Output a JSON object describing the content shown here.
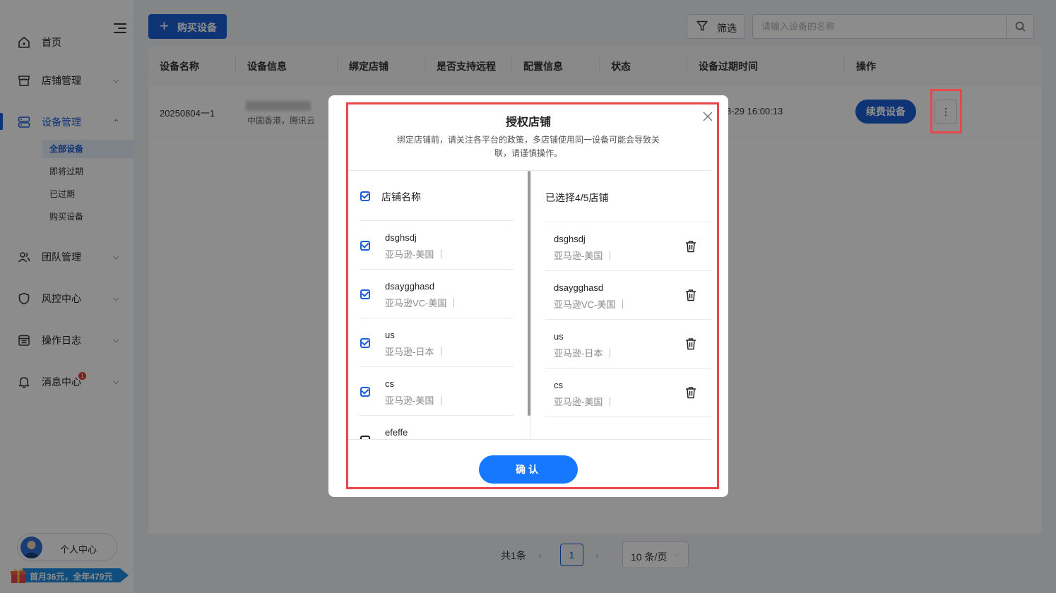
{
  "sidebar": {
    "nav": [
      {
        "label": "首页",
        "icon": "home-icon"
      },
      {
        "label": "店铺管理",
        "icon": "store-icon"
      },
      {
        "label": "设备管理",
        "icon": "device-icon"
      },
      {
        "label": "团队管理",
        "icon": "team-icon"
      },
      {
        "label": "风控中心",
        "icon": "shield-icon"
      },
      {
        "label": "操作日志",
        "icon": "log-icon"
      },
      {
        "label": "消息中心",
        "icon": "bell-icon"
      }
    ],
    "sub_items": [
      "全部设备",
      "即将过期",
      "已过期",
      "购买设备"
    ],
    "message_badge": "1",
    "profile_label": "个人中心",
    "promo_text": "首月36元，全年479元"
  },
  "toolbar": {
    "buy_label": "购买设备",
    "filter_label": "筛选",
    "search_placeholder": "请输入设备的名称"
  },
  "table": {
    "columns": [
      "设备名称",
      "设备信息",
      "绑定店铺",
      "是否支持远程",
      "配置信息",
      "状态",
      "设备过期时间",
      "操作"
    ],
    "row": {
      "name": "20250804一1",
      "info_sub": "中国香港，腾讯云",
      "expire": "8-29 16:00:13",
      "renew_label": "续费设备",
      "more_label": "⋮"
    }
  },
  "pagination": {
    "total": "共1条",
    "page": "1",
    "page_size": "10 条/页"
  },
  "modal": {
    "title": "授权店铺",
    "note": "绑定店铺前，请关注各平台的政策，多店铺使用同一设备可能会导致关联，请谨慎操作。",
    "left_header": "店铺名称",
    "right_header": "已选择4/5店铺",
    "shops": [
      {
        "name": "dsghsdj",
        "sub": "亚马逊-美国 ｜",
        "checked": true
      },
      {
        "name": "dsaygghasd",
        "sub": "亚马逊VC-美国 ｜",
        "checked": true
      },
      {
        "name": "us",
        "sub": "亚马逊-日本 ｜",
        "checked": true
      },
      {
        "name": "cs",
        "sub": "亚马逊-美国 ｜",
        "checked": true
      },
      {
        "name": "efeffe",
        "sub": "",
        "checked": false
      }
    ],
    "selected": [
      {
        "name": "dsghsdj",
        "sub": "亚马逊-美国 ｜"
      },
      {
        "name": "dsaygghasd",
        "sub": "亚马逊VC-美国 ｜"
      },
      {
        "name": "us",
        "sub": "亚马逊-日本 ｜"
      },
      {
        "name": "cs",
        "sub": "亚马逊-美国 ｜"
      }
    ],
    "confirm_label": "确认"
  },
  "colors": {
    "primary": "#1b5fd6",
    "confirm": "#1677ff",
    "highlight": "#e8484b"
  }
}
